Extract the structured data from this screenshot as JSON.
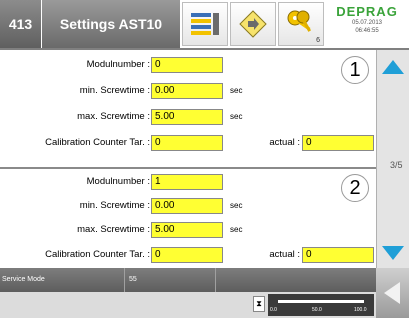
{
  "header": {
    "screen_number": "413",
    "title": "Settings AST10",
    "logo": "DEPRAG",
    "date": "05.07.2013",
    "time": "06:46:55",
    "key_badge": "6"
  },
  "panels": [
    {
      "index": "1",
      "modulnumber_label": "Modulnumber :",
      "modulnumber_value": "0",
      "min_label": "min. Screwtime :",
      "min_value": "0.00",
      "min_unit": "sec",
      "max_label": "max. Screwtime :",
      "max_value": "5.00",
      "max_unit": "sec",
      "cal_label": "Calibration Counter Tar. :",
      "cal_value": "0",
      "actual_label": "actual :",
      "actual_value": "0"
    },
    {
      "index": "2",
      "modulnumber_label": "Modulnumber :",
      "modulnumber_value": "1",
      "min_label": "min. Screwtime :",
      "min_value": "0.00",
      "min_unit": "sec",
      "max_label": "max. Screwtime :",
      "max_value": "5.00",
      "max_unit": "sec",
      "cal_label": "Calibration Counter Tar. :",
      "cal_value": "0",
      "actual_label": "actual :",
      "actual_value": "0"
    }
  ],
  "pager": {
    "text": "3/5"
  },
  "status": {
    "mode": "Service Mode",
    "code": "55"
  },
  "scale": {
    "t0": "0.0",
    "t50": "50.0",
    "t100": "100.0"
  },
  "colors": {
    "field": "#ffff33",
    "accent": "#1f9fd7",
    "logo": "#3aa33a"
  }
}
